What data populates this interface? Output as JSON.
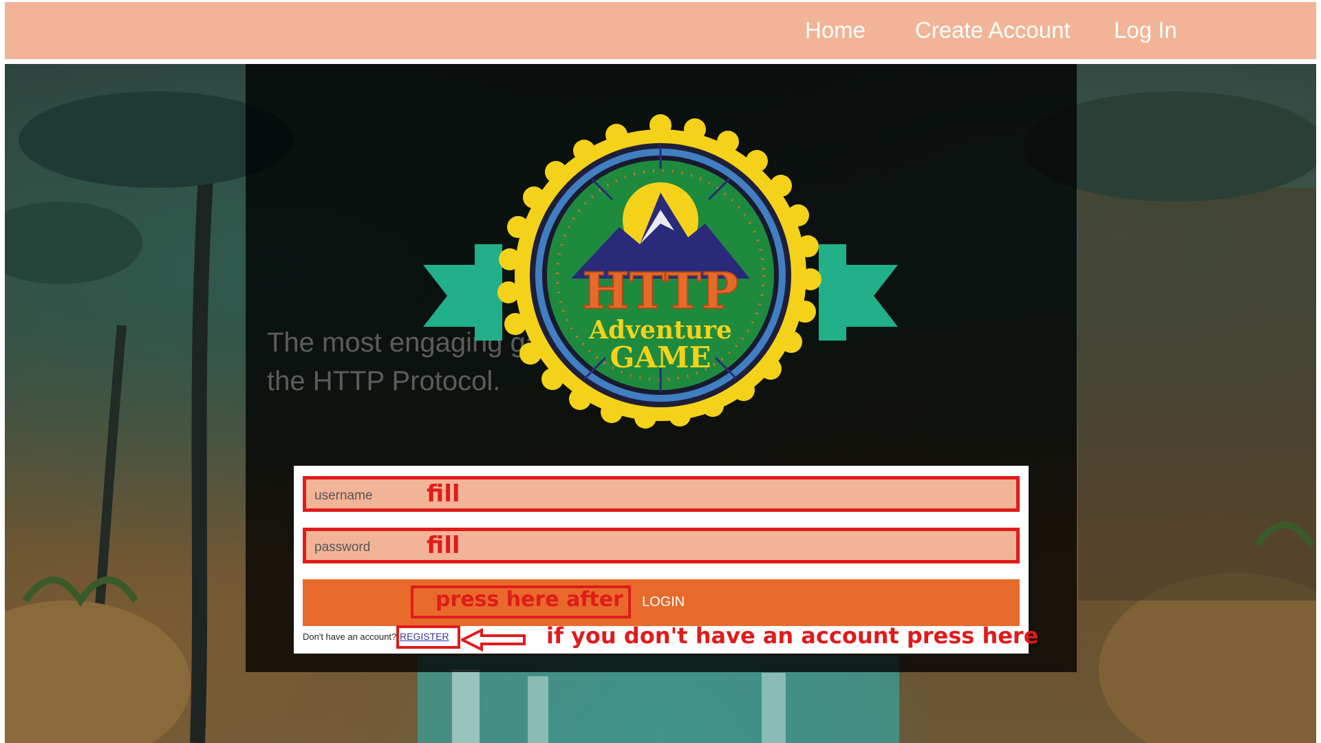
{
  "nav": {
    "home": "Home",
    "create_account": "Create Account",
    "log_in": "Log In"
  },
  "hero": {
    "tagline_line1": "The most engaging game",
    "tagline_line2": "the HTTP Protocol."
  },
  "logo": {
    "title": "HTTP",
    "subtitle1": "Adventure",
    "subtitle2": "GAME"
  },
  "form": {
    "username_placeholder": "username",
    "password_placeholder": "password",
    "login_label": "LOGIN",
    "no_account_text": "Don't have an account?",
    "register_label": "REGISTER"
  },
  "annotations": {
    "fill_username": "fill",
    "fill_password": "fill",
    "press_here_after": "press here after",
    "register_hint": "if you don't have an account press here"
  },
  "colors": {
    "nav_bg": "#f2b497",
    "annotation_red": "#e01b1b",
    "login_orange": "#e86a2a",
    "input_bg": "#f2b497"
  }
}
